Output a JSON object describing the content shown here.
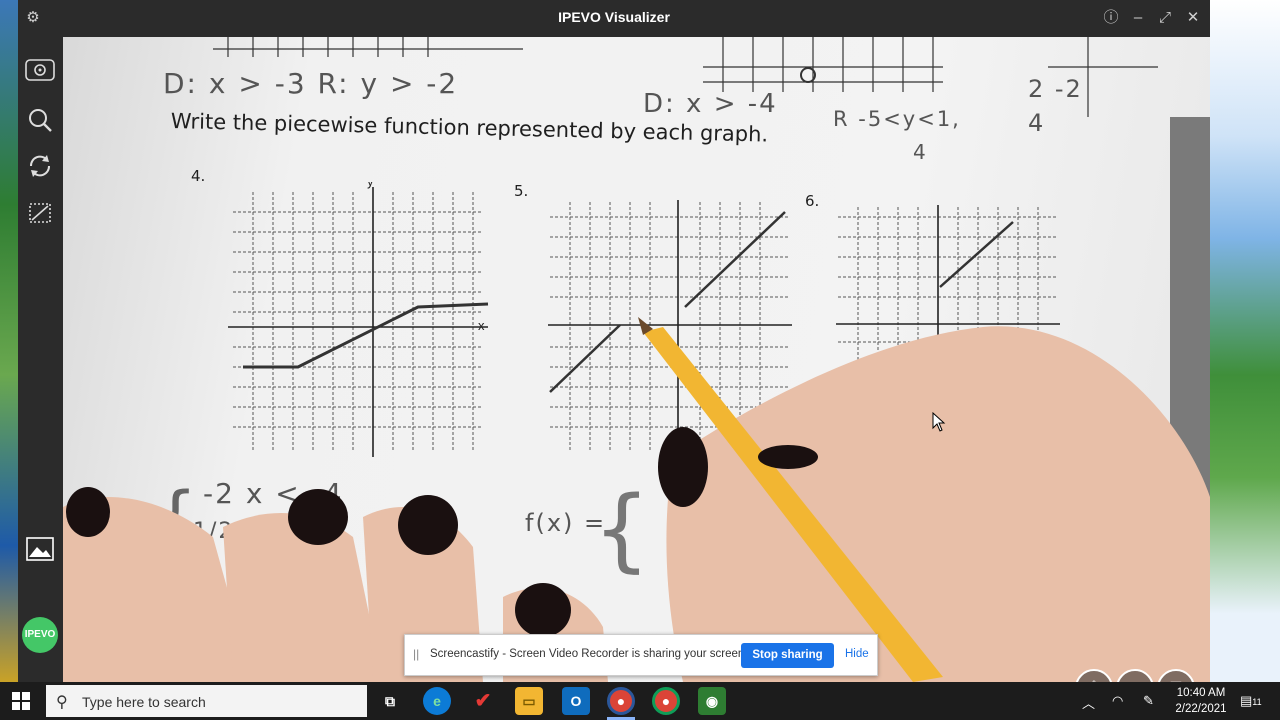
{
  "window": {
    "title": "IPEVO Visualizer",
    "logo_text": "IPEVO"
  },
  "document": {
    "heading": "Write the piecewise function represented by each graph.",
    "problems": [
      "4.",
      "5.",
      "6."
    ],
    "axis_x": "x",
    "axis_y": "y",
    "handwriting": {
      "top_left": "D: x > -3   R: y > -2",
      "top_right_domain": "D: x > -4",
      "top_right_range": "R -5<y<1,",
      "top_right_extra": "4",
      "table": [
        "2  -2",
        "4"
      ],
      "answer4_line1": "-2      x < -4",
      "answer4_line2": "1/2",
      "answer5": "f(x) ="
    }
  },
  "screencastify": {
    "message": "Screencastify - Screen Video Recorder is sharing your screen.",
    "stop_label": "Stop sharing",
    "hide_label": "Hide"
  },
  "taskbar": {
    "search_placeholder": "Type here to search",
    "time": "10:40 AM",
    "date": "2/22/2021",
    "notifications": "11"
  },
  "colors": {
    "accent_blue": "#1a73e8",
    "ipevo_green": "#44c767",
    "titlebar": "#2b2b2b"
  }
}
